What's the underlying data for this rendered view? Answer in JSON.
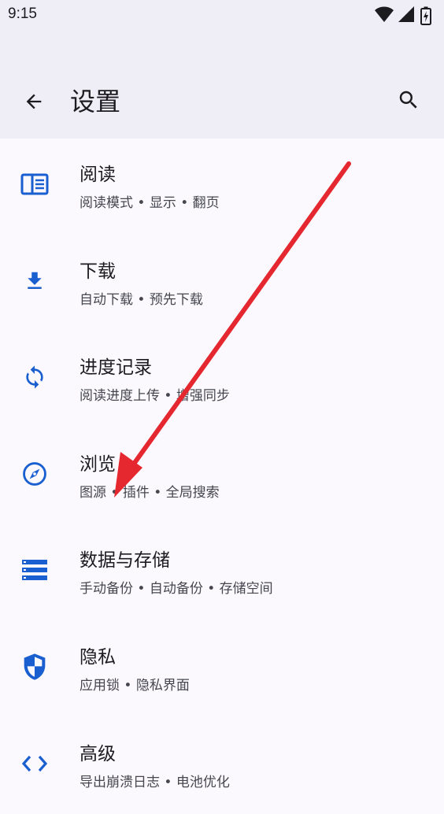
{
  "status_bar": {
    "time": "9:15",
    "icons": [
      "wifi-icon",
      "signal-icon",
      "battery-charging-icon"
    ]
  },
  "app_bar": {
    "title": "设置",
    "back_icon": "arrow-back-icon",
    "search_icon": "search-icon"
  },
  "colors": {
    "accent": "#1a5fcf",
    "app_bar_bg": "#efedf5",
    "page_bg": "#fbf9fe",
    "annotation_arrow": "#e5272f"
  },
  "settings": [
    {
      "icon": "book-reader-icon",
      "title": "阅读",
      "subtitle": "阅读模式 • 显示 • 翻页"
    },
    {
      "icon": "download-icon",
      "title": "下载",
      "subtitle": "自动下载 • 预先下载"
    },
    {
      "icon": "sync-icon",
      "title": "进度记录",
      "subtitle": "阅读进度上传 • 增强同步"
    },
    {
      "icon": "compass-icon",
      "title": "浏览",
      "subtitle": "图源 • 插件 • 全局搜索"
    },
    {
      "icon": "storage-icon",
      "title": "数据与存储",
      "subtitle": "手动备份 • 自动备份 • 存储空间"
    },
    {
      "icon": "shield-icon",
      "title": "隐私",
      "subtitle": "应用锁 • 隐私界面"
    },
    {
      "icon": "code-icon",
      "title": "高级",
      "subtitle": "导出崩溃日志 • 电池优化"
    }
  ]
}
